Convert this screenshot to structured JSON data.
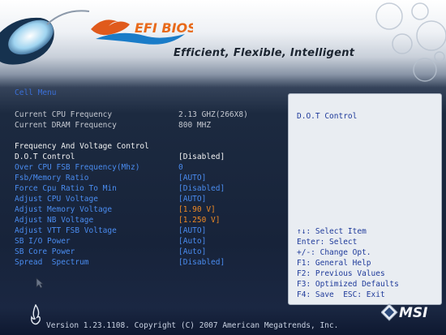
{
  "header": {
    "logo_text": "EFI BIOS",
    "tagline": "Efficient, Flexible, Intelligent"
  },
  "menu": {
    "title": "Cell Menu",
    "info_rows": [
      {
        "label": "Current CPU Frequency",
        "value": "2.13 GHZ(266X8)"
      },
      {
        "label": "Current DRAM Frequency",
        "value": "800 MHZ"
      }
    ],
    "section_heading": "Frequency And Voltage Control",
    "settings": [
      {
        "label": "D.O.T Control",
        "value": "[Disabled]"
      },
      {
        "label": "Over CPU FSB Frequency(Mhz)",
        "value": "0"
      },
      {
        "label": "Fsb/Memory Ratio",
        "value": "[AUTO]"
      },
      {
        "label": "Force Cpu Ratio To Min",
        "value": "[Disabled]"
      },
      {
        "label": "Adjust CPU Voltage",
        "value": "[AUTO]"
      },
      {
        "label": "Adjust Memory Voltage",
        "value": "[1.90 V]"
      },
      {
        "label": "Adjust NB Voltage",
        "value": "[1.250 V]"
      },
      {
        "label": "Adjust VTT FSB Voltage",
        "value": "[AUTO]"
      },
      {
        "label": "SB I/O Power",
        "value": "[Auto]"
      },
      {
        "label": "SB Core Power",
        "value": "[Auto]"
      },
      {
        "label": "Spread  Spectrum",
        "value": "[Disabled]"
      }
    ]
  },
  "help": {
    "title": "D.O.T Control",
    "keys": [
      "↑↓: Select Item",
      "Enter: Select",
      "+/-: Change Opt.",
      "F1: General Help",
      "F2: Previous Values",
      "F3: Optimized Defaults",
      "F4: Save  ESC: Exit"
    ]
  },
  "footer": {
    "version_text": "Version 1.23.1108. Copyright (C) 2007 American Megatrends, Inc.",
    "brand": "MSI"
  },
  "colors": {
    "selected": "#f2f2f2",
    "option": "#4a8cf0",
    "value_orange": "#f08a24",
    "info": "#c4c8d0",
    "help_text": "#1e3a9a"
  }
}
